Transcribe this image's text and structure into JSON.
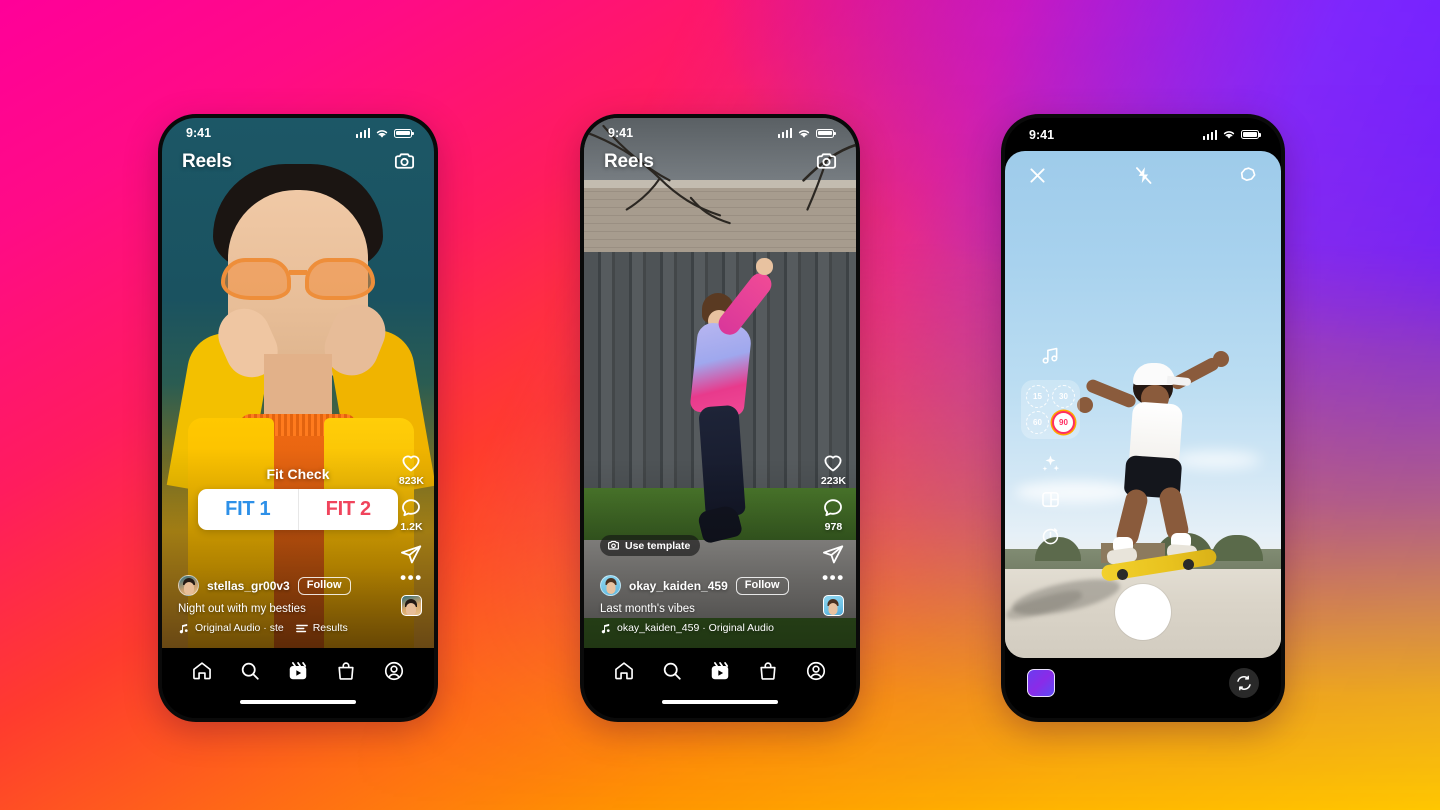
{
  "background": {
    "gradient_start": "#FF0099",
    "gradient_mid": "#FF3B2E",
    "gradient_end": "#FFC700",
    "accent_purple": "#6C1CFC"
  },
  "phones": [
    {
      "id": "reels-poll",
      "statusbar": {
        "time": "9:41",
        "signal_icon": "cellular-bars-icon",
        "wifi_icon": "wifi-icon",
        "battery_icon": "battery-full-icon"
      },
      "header": {
        "title": "Reels",
        "camera_icon": "camera-icon"
      },
      "poll": {
        "question": "Fit Check",
        "option_a": "FIT 1",
        "option_b": "FIT 2",
        "color_a": "#2D90E8",
        "color_b": "#F0445C"
      },
      "rail": {
        "like_icon": "heart-icon",
        "like_count": "823K",
        "comment_icon": "comment-icon",
        "comment_count": "1.2K",
        "share_icon": "share-paperplane-icon",
        "more_icon": "more-dots-icon",
        "audio_thumb": "audio-cover-thumbnail"
      },
      "meta": {
        "username": "stellas_gr00v3",
        "follow_label": "Follow",
        "caption": "Night out with my besties",
        "audio_icon": "music-note-icon",
        "audio_label": "Original Audio · ste",
        "results_icon": "poll-results-icon",
        "results_label": "Results"
      },
      "tabbar": [
        {
          "name": "tab-home",
          "icon": "home-icon"
        },
        {
          "name": "tab-search",
          "icon": "search-icon"
        },
        {
          "name": "tab-reels",
          "icon": "reels-icon"
        },
        {
          "name": "tab-shop",
          "icon": "shop-bag-icon"
        },
        {
          "name": "tab-profile",
          "icon": "profile-icon"
        }
      ]
    },
    {
      "id": "reels-template",
      "statusbar": {
        "time": "9:41",
        "signal_icon": "cellular-bars-icon",
        "wifi_icon": "wifi-icon",
        "battery_icon": "battery-full-icon"
      },
      "header": {
        "title": "Reels",
        "camera_icon": "camera-icon"
      },
      "template_pill": {
        "icon": "camera-icon",
        "label": "Use template"
      },
      "rail": {
        "like_icon": "heart-icon",
        "like_count": "223K",
        "comment_icon": "comment-icon",
        "comment_count": "978",
        "share_icon": "share-paperplane-icon",
        "more_icon": "more-dots-icon",
        "audio_thumb": "audio-cover-thumbnail"
      },
      "meta": {
        "username": "okay_kaiden_459",
        "follow_label": "Follow",
        "caption": "Last month's vibes",
        "audio_icon": "music-note-icon",
        "audio_label": "okay_kaiden_459 · Original Audio"
      },
      "tabbar": [
        {
          "name": "tab-home",
          "icon": "home-icon"
        },
        {
          "name": "tab-search",
          "icon": "search-icon"
        },
        {
          "name": "tab-reels",
          "icon": "reels-icon"
        },
        {
          "name": "tab-shop",
          "icon": "shop-bag-icon"
        },
        {
          "name": "tab-profile",
          "icon": "profile-icon"
        }
      ]
    },
    {
      "id": "reels-camera",
      "statusbar": {
        "time": "9:41",
        "signal_icon": "cellular-bars-icon",
        "wifi_icon": "wifi-icon",
        "battery_icon": "battery-full-icon"
      },
      "top_controls": {
        "close_icon": "close-x-icon",
        "flash_icon": "flash-off-icon",
        "settings_icon": "sparkle-settings-icon"
      },
      "left_tools": {
        "audio_icon": "music-note-icon",
        "durations": [
          "15",
          "30",
          "60",
          "90"
        ],
        "selected_duration": "90",
        "selected_color": "#FF2E63",
        "effects_icon": "sparkles-icon",
        "layout_icon": "layout-split-icon",
        "timer_icon": "timer-icon"
      },
      "bottom": {
        "gallery_icon": "gallery-thumbnail",
        "shutter_icon": "capture-button",
        "flip_icon": "camera-flip-icon"
      }
    }
  ]
}
